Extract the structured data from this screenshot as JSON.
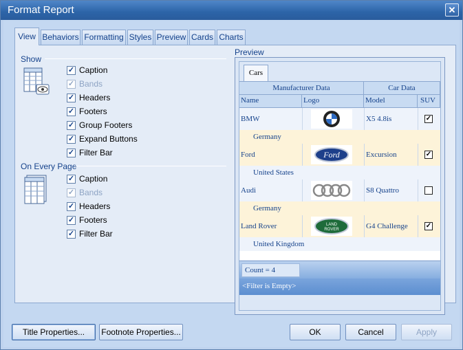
{
  "window": {
    "title": "Format Report",
    "close_glyph": "✕"
  },
  "tabs": [
    {
      "label": "View",
      "active": true
    },
    {
      "label": "Behaviors"
    },
    {
      "label": "Formatting"
    },
    {
      "label": "Styles"
    },
    {
      "label": "Preview"
    },
    {
      "label": "Cards"
    },
    {
      "label": "Charts"
    }
  ],
  "show": {
    "heading": "Show",
    "items": [
      {
        "label": "Caption",
        "checked": true
      },
      {
        "label": "Bands",
        "checked": true,
        "disabled": true
      },
      {
        "label": "Headers",
        "checked": true
      },
      {
        "label": "Footers",
        "checked": true
      },
      {
        "label": "Group Footers",
        "checked": true
      },
      {
        "label": "Expand Buttons",
        "checked": true
      },
      {
        "label": "Filter Bar",
        "checked": true
      }
    ]
  },
  "every_page": {
    "heading": "On Every Page",
    "items": [
      {
        "label": "Caption",
        "checked": true
      },
      {
        "label": "Bands",
        "checked": true,
        "disabled": true
      },
      {
        "label": "Headers",
        "checked": true
      },
      {
        "label": "Footers",
        "checked": true
      },
      {
        "label": "Filter Bar",
        "checked": true
      }
    ]
  },
  "preview": {
    "label": "Preview",
    "tab": "Cars",
    "bands": [
      "Manufacturer Data",
      "Car Data"
    ],
    "columns": [
      "Name",
      "Logo",
      "Model",
      "SUV"
    ],
    "rows": [
      {
        "name": "BMW",
        "model": "X5 4.8is",
        "suv": true,
        "country": "Germany",
        "logo": "bmw-logo"
      },
      {
        "name": "Ford",
        "model": "Excursion",
        "suv": true,
        "country": "United States",
        "logo": "ford-logo"
      },
      {
        "name": "Audi",
        "model": "S8 Quattro",
        "suv": false,
        "country": "Germany",
        "logo": "audi-logo"
      },
      {
        "name": "Land Rover",
        "model": "G4 Challenge",
        "suv": true,
        "country": "United Kingdom",
        "logo": "landrover-logo"
      }
    ],
    "count": "Count = 4",
    "filter": "<Filter is Empty>",
    "logo_text": {
      "ford": "Ford",
      "landrover_top": "LAND",
      "landrover_bottom": "ROVER"
    }
  },
  "buttons": {
    "title_properties": "Title Properties...",
    "footnote_properties": "Footnote Properties...",
    "ok": "OK",
    "cancel": "Cancel",
    "apply": "Apply"
  },
  "colors": {
    "accent": "#15428b",
    "header": "#c8dbf2",
    "row_alt": "#fdf3d9"
  }
}
